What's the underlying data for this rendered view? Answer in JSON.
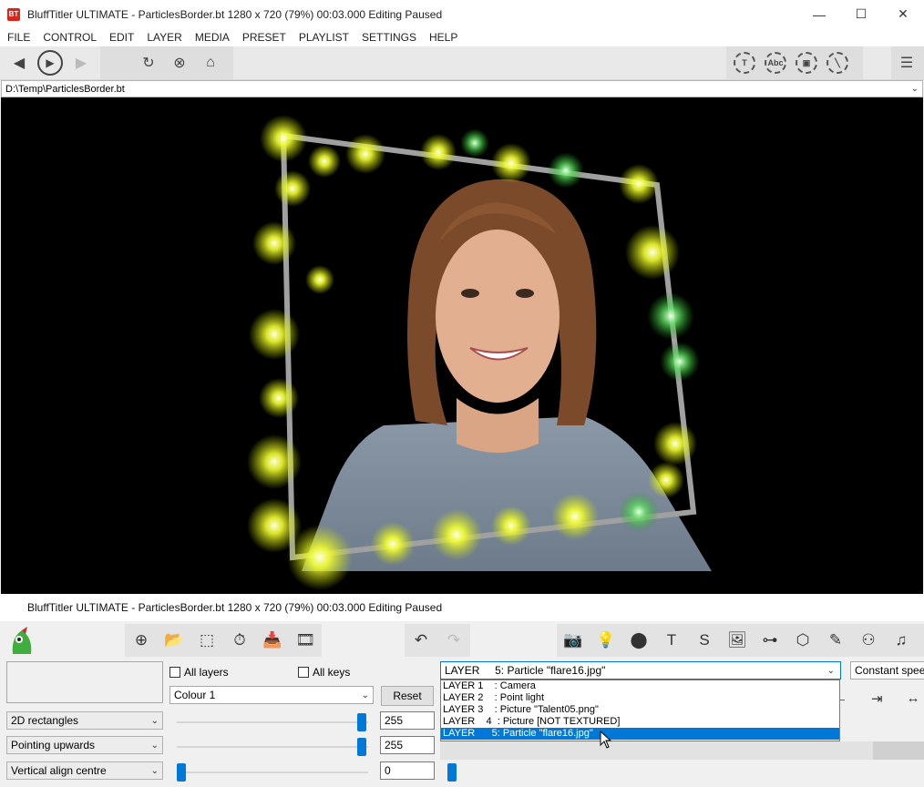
{
  "window": {
    "logo": "BT",
    "title": "BluffTitler ULTIMATE  - ParticlesBorder.bt 1280 x 720 (79%) 00:03.000 Editing Paused",
    "min": "—",
    "max": "☐",
    "close": "✕"
  },
  "menu": [
    "FILE",
    "CONTROL",
    "EDIT",
    "LAYER",
    "MEDIA",
    "PRESET",
    "PLAYLIST",
    "SETTINGS",
    "HELP"
  ],
  "toolbar": {
    "back_icon": "◀",
    "play_icon": "▶",
    "forward_icon": "▶",
    "refresh_icon": "↻",
    "stop_icon": "⊗",
    "home_icon": "⌂",
    "right_icons": [
      "T",
      "Abc",
      "▣",
      "╲"
    ],
    "menu_icon": "☰"
  },
  "path": {
    "value": "D:\\Temp\\ParticlesBorder.bt",
    "chevron": "⌄"
  },
  "status": {
    "text": "BluffTitler ULTIMATE  - ParticlesBorder.bt 1280 x 720 (79%) 00:03.000 Editing Paused"
  },
  "bottom_toolbar": {
    "left_icons": [
      "⊕",
      "📂",
      "⬚",
      "⏱",
      "📥",
      "🎞"
    ],
    "undo": "↶",
    "redo": "↷",
    "layer_icons": [
      "📷",
      "💡",
      "⬤",
      "T",
      "S",
      "🖼",
      "⊶",
      "⬡",
      "✎",
      "⚇",
      "♫"
    ]
  },
  "controls": {
    "all_layers": "All layers",
    "all_keys": "All keys",
    "colour_select": "Colour 1",
    "reset_label": "Reset",
    "dropdowns": [
      "2D rectangles",
      "Pointing upwards",
      "Vertical align centre"
    ],
    "values": [
      "255",
      "255",
      "0"
    ],
    "layer_selected": "LAYER     5: Particle \"flare16.jpg\"",
    "layer_options": [
      "LAYER 1    : Camera",
      "LAYER 2    : Point light",
      "LAYER 3    : Picture \"Talent05.png\"",
      "LAYER    4  : Picture [NOT TEXTURED]",
      "LAYER      5: Particle \"flare16.jpg\""
    ],
    "speed": "Constant speed",
    "right_icons": [
      "←",
      "⇥",
      "↔"
    ]
  }
}
